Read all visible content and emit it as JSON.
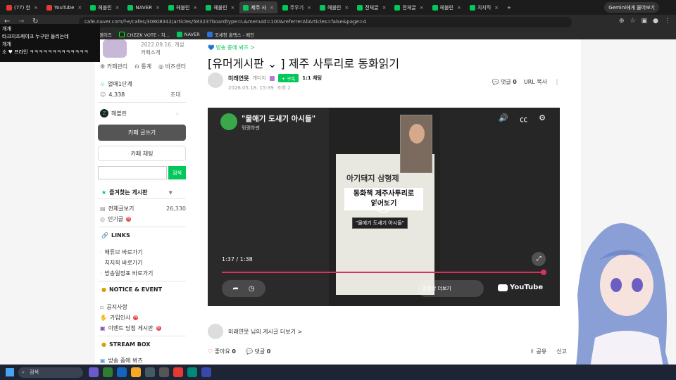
{
  "browser": {
    "tabs": [
      {
        "label": "(77) 한",
        "color": "#e53935"
      },
      {
        "label": "YouTube",
        "color": "#e53935"
      },
      {
        "label": "헤블린",
        "color": "#03c75a"
      },
      {
        "label": "NAVER",
        "color": "#03c75a"
      },
      {
        "label": "헤블린",
        "color": "#03c75a"
      },
      {
        "label": "헤블린",
        "color": "#03c75a"
      },
      {
        "label": "제주 사",
        "color": "#03c75a",
        "active": true
      },
      {
        "label": "주우기",
        "color": "#03c75a"
      },
      {
        "label": "헤블린",
        "color": "#03c75a"
      },
      {
        "label": "전체글",
        "color": "#03c75a"
      },
      {
        "label": "전체글",
        "color": "#03c75a"
      },
      {
        "label": "헤블린",
        "color": "#03c75a"
      },
      {
        "label": "치지직",
        "color": "#03c75a"
      }
    ],
    "new_tab": "+",
    "gemini": "Gemini에게 물어보기",
    "url": "cafe.naver.com/f-e/cafes/30808342/articles/583237boardtype=L&menuid=100&referrerAllArticles=false&page=4",
    "bookmarks": [
      "만료엠이즈",
      "CHZZK VOTE - 치...",
      "NAVER",
      "국세청 홈택스 - 메인"
    ],
    "bookmark_first": "타크로도 -",
    "bookmark_label": "민르샤이도 C쪽..."
  },
  "overlay": {
    "line1": "개개",
    "line2": "타크지즈케이크 누구만 들리는데",
    "line3": "개개",
    "line4": "소 ♥ 프라인 ㅋㅋㅋㅋㅋㅋㅋㅋㅋㅋㅋㅋㅋ"
  },
  "sidebar": {
    "since": "2022.09.16. 개설",
    "cafe_intro": "카페소개",
    "links": [
      "카페관리",
      "통계",
      "비즈센터"
    ],
    "level": "열매1단계",
    "members": "4,338",
    "invite": "초대",
    "manager": "헤블린",
    "write": "카페 글쓰기",
    "chat": "카페 채팅",
    "search_btn": "검색",
    "fav_title": "즐겨찾는 게시판",
    "all_posts": "전체글보기",
    "all_count": "26,330",
    "popular": "인기글",
    "links_title": "LINKS",
    "link_items": [
      "해튜브 바로가기",
      "치지직 바로가기",
      "방송일정표 바로가기"
    ],
    "notice_title": "NOTICE & EVENT",
    "notice_items": [
      "공지사항",
      "가입인사",
      "이벤트 당첨 게시판"
    ],
    "stream_title": "STREAM BOX",
    "stream_item": "방송 중에 봐즈",
    "new_badge": "N"
  },
  "article": {
    "breadcrumb": "방송 중에 봐즈 >",
    "title": "[유머게시판 ⌄ ] 제주 사투리로 동화읽기",
    "author": "미래연못",
    "author_level": "개디지",
    "subscribe": "+ 구독",
    "chat": "1:1 채팅",
    "date": "2026.05.18. 15:39",
    "views": "조회 2",
    "comments_label": "댓글",
    "comments_count": "0",
    "url_copy": "URL 복사",
    "more_posts": "미래연못 님의 게시글 더보기 >",
    "like_label": "좋아요",
    "like_count": "0",
    "comment_label": "댓글",
    "comment_count": "0",
    "share": "공유",
    "report": "신고"
  },
  "video": {
    "title": "\"물애기 도새기 아시들\"",
    "channel": "뭐랭하멘",
    "book_title": "아기돼지 삼형제",
    "caption_main": "동화책 제주사투리로\n읽어보기",
    "caption_sub": "\"물애기 도새기 아시들\"",
    "time": "1:37 / 1:38",
    "more_videos": "동영상 더보기",
    "youtube": "YouTube",
    "progress": 0.99
  },
  "taskbar": {
    "search": "검색"
  }
}
